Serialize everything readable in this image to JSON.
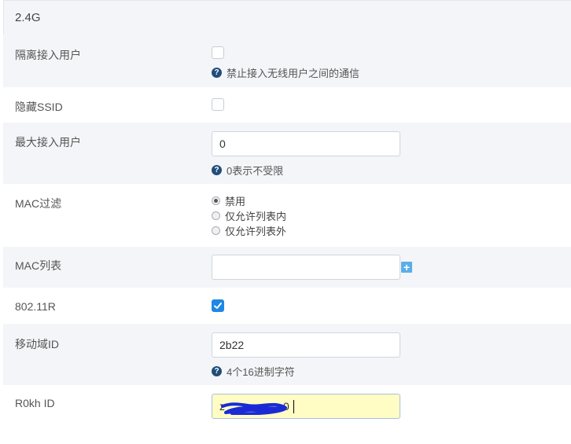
{
  "panel": {
    "title": "2.4G"
  },
  "rows": {
    "isolate": {
      "label": "隔离接入用户",
      "checked": false,
      "help": "禁止接入无线用户之间的通信"
    },
    "hide_ssid": {
      "label": "隐藏SSID",
      "checked": false
    },
    "max_clients": {
      "label": "最大接入用户",
      "value": "0",
      "help": "0表示不受限"
    },
    "mac_filter": {
      "label": "MAC过滤",
      "options": [
        "禁用",
        "仅允许列表内",
        "仅允许列表外"
      ],
      "selected": "禁用"
    },
    "mac_list": {
      "label": "MAC列表",
      "value": "",
      "add_symbol": "+"
    },
    "dot11r": {
      "label": "802.11R",
      "checked": true
    },
    "mobility_domain": {
      "label": "移动域ID",
      "value": "2b22",
      "help": "4个16进制字符"
    },
    "r0kh_id": {
      "label": "R0kh ID",
      "value_visible_start": "z",
      "value_visible_end": "0"
    }
  },
  "colors": {
    "accent": "#1e88e5",
    "help_icon": "#1f4e79",
    "add_button": "#5aaee8",
    "focused_input": "#fffdc4",
    "redaction": "#1a2bd6"
  },
  "icons": {
    "help": "question-circle-icon",
    "add": "plus-icon",
    "check": "checkmark-icon"
  }
}
